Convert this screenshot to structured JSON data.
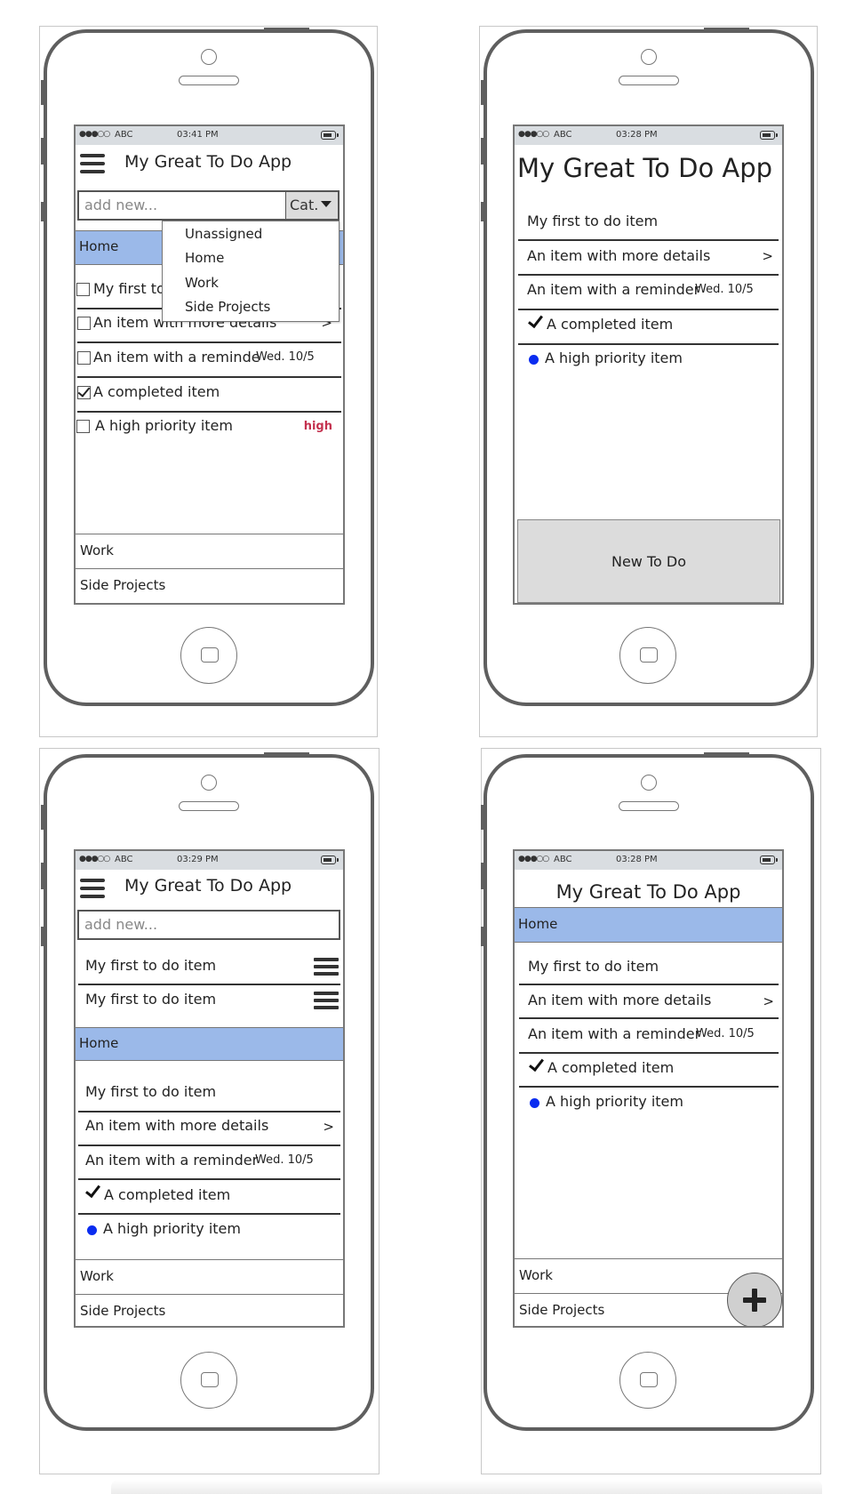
{
  "mockups": {
    "phone1": {
      "status": {
        "signal": "●●●○○",
        "carrier": "ABC",
        "time": "03:41 PM"
      },
      "title": "My Great To Do App",
      "input_placeholder": "add new...",
      "category_button": "Cat.",
      "category_menu": [
        "Unassigned",
        "Home",
        "Work",
        "Side Projects"
      ],
      "active_category": "Home",
      "items": [
        {
          "text": "My first to do item",
          "checked": false
        },
        {
          "text": "An item with more details",
          "checked": false,
          "accessory": ">"
        },
        {
          "text": "An item with a reminde",
          "checked": false,
          "date": "Wed. 10/5"
        },
        {
          "text": "A completed item",
          "checked": true
        },
        {
          "text": "A high priority item",
          "checked": false,
          "priority": "high"
        }
      ],
      "other_categories": [
        "Work",
        "Side Projects"
      ]
    },
    "phone2": {
      "status": {
        "signal": "●●●○○",
        "carrier": "ABC",
        "time": "03:28 PM"
      },
      "title": "My Great To Do App",
      "items": [
        {
          "text": "My first to do item"
        },
        {
          "text": "An item with more details",
          "accessory": ">"
        },
        {
          "text": "An item with a reminder",
          "date": "Wed. 10/5"
        },
        {
          "text": "A completed item",
          "marker": "check"
        },
        {
          "text": "A high priority item",
          "marker": "dot"
        }
      ],
      "new_button": "New To Do"
    },
    "phone3": {
      "status": {
        "signal": "●●●○○",
        "carrier": "ABC",
        "time": "03:29 PM"
      },
      "title": "My Great To Do App",
      "input_placeholder": "add new...",
      "draggable_items": [
        "My first to do item",
        "My first to do item"
      ],
      "active_category": "Home",
      "items": [
        {
          "text": "My first to do item"
        },
        {
          "text": "An item with more details",
          "accessory": ">"
        },
        {
          "text": "An item with a reminder",
          "date": "Wed. 10/5"
        },
        {
          "text": "A completed item",
          "marker": "check"
        },
        {
          "text": "A high priority item",
          "marker": "dot"
        }
      ],
      "other_categories": [
        "Work",
        "Side Projects"
      ]
    },
    "phone4": {
      "status": {
        "signal": "●●●○○",
        "carrier": "ABC",
        "time": "03:28 PM"
      },
      "title": "My Great To Do App",
      "active_category": "Home",
      "items": [
        {
          "text": "My first to do item"
        },
        {
          "text": "An item with more details",
          "accessory": ">"
        },
        {
          "text": "An item with a reminder",
          "date": "Wed. 10/5"
        },
        {
          "text": "A completed item",
          "marker": "check"
        },
        {
          "text": "A high priority item",
          "marker": "dot"
        }
      ],
      "other_categories": [
        "Work",
        "Side Projects"
      ],
      "fab_icon": "plus-icon"
    }
  },
  "colors": {
    "category_highlight": "#9bb9e9",
    "status_bar": "#d9dde1",
    "priority_high": "#c4324f",
    "priority_dot": "#0a2cf0",
    "button_gray": "#dcdcdc"
  }
}
